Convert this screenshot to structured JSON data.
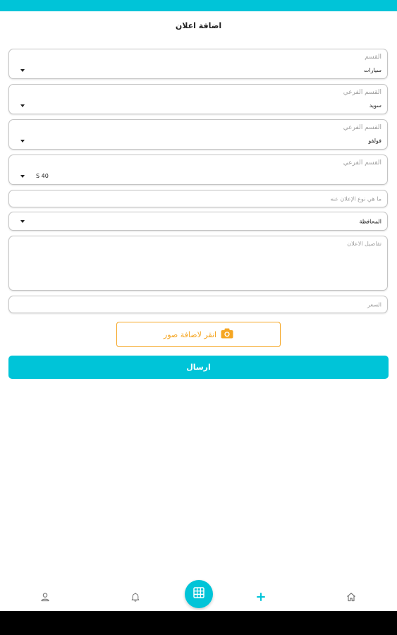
{
  "header": {
    "title": "اضافة اعلان"
  },
  "form": {
    "category": {
      "label": "القسم",
      "value": "سيارات"
    },
    "subcategory1": {
      "label": "القسم الفرعي",
      "value": "سويد"
    },
    "subcategory2": {
      "label": "القسم الفرعي",
      "value": "فولفو"
    },
    "subcategory3": {
      "label": "القسم الفرعي",
      "value": "S 40"
    },
    "ad_type": {
      "placeholder": "ما هي نوع الإعلان عنه"
    },
    "governorate": {
      "value": "المحافظة"
    },
    "details": {
      "placeholder": "تفاصيل الاعلان"
    },
    "price": {
      "placeholder": "السعر"
    },
    "add_photos_label": "انقر لاضافة صور",
    "submit_label": "ارسال"
  },
  "nav": {
    "items": [
      "home-icon",
      "plus-icon",
      "grid-icon",
      "bell-icon",
      "user-icon"
    ]
  },
  "colors": {
    "accent": "#00c4d8",
    "photo_button": "#f5a623"
  }
}
